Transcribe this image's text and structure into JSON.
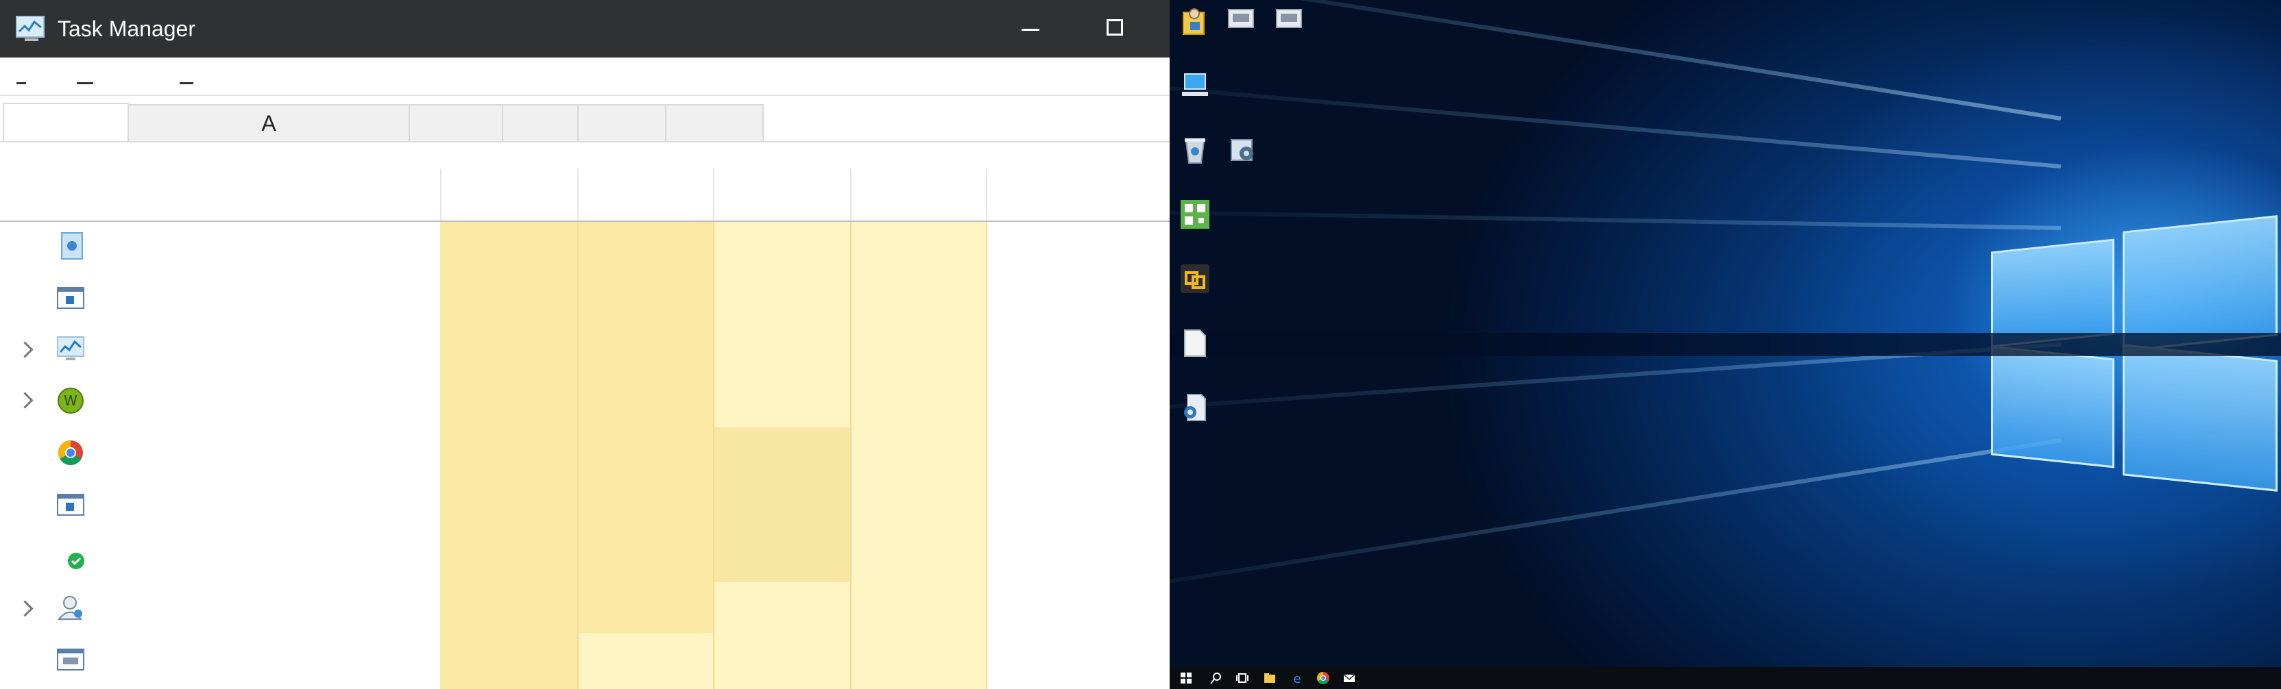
{
  "window": {
    "title": "Task Manager",
    "minimize_icon": "minimize-icon",
    "maximize_icon": "maximize-icon"
  },
  "tabs": [
    {
      "label": ""
    },
    {
      "label": "A"
    },
    {
      "label": ""
    },
    {
      "label": ""
    },
    {
      "label": ""
    },
    {
      "label": ""
    }
  ],
  "process_rows": [
    {
      "icon": "service-host-icon",
      "expandable": false
    },
    {
      "icon": "window-app-icon",
      "expandable": false
    },
    {
      "icon": "task-manager-icon",
      "expandable": true
    },
    {
      "icon": "wireshark-icon",
      "expandable": true
    },
    {
      "icon": "chrome-icon",
      "expandable": false
    },
    {
      "icon": "window-app-icon",
      "expandable": false
    },
    {
      "icon": "green-check-icon",
      "expandable": false
    },
    {
      "icon": "user-accounts-icon",
      "expandable": true
    },
    {
      "icon": "window-app-icon",
      "expandable": false
    }
  ],
  "desktop": {
    "icons": [
      "user-folder-icon",
      "shortcut-icon",
      "shortcut-icon",
      "this-pc-icon",
      "recycle-bin-icon",
      "control-panel-icon",
      "qr-app-icon",
      "vmware-icon",
      "document-icon",
      "network-app-icon"
    ],
    "taskbar_icons": [
      "start-icon",
      "search-icon",
      "task-view-icon",
      "file-explorer-icon",
      "edge-icon",
      "chrome-icon",
      "mail-icon"
    ]
  },
  "colors": {
    "titlebar": "#2f3133",
    "heat_light": "#fff4c4",
    "heat_dark": "#fce9a6",
    "desktop_blue": "#0b5fb8"
  }
}
